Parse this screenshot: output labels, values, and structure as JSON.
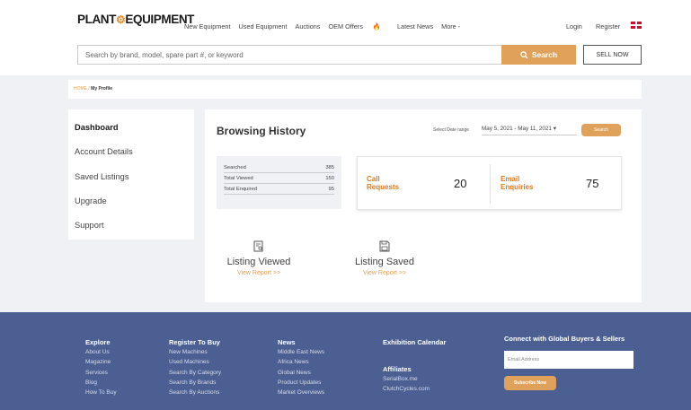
{
  "header": {
    "logo": "PLANT & EQUIPMENT",
    "nav": [
      "New Equipment",
      "Used Equipment",
      "Auctions",
      "OEM Offers",
      "Latest News",
      "More -"
    ],
    "login": "Login",
    "register": "Register"
  },
  "search": {
    "placeholder": "Search by brand, model, spare part #, or keyword",
    "button": "Search",
    "sell": "SELL NOW"
  },
  "breadcrumb": {
    "home": "HOME",
    "separator": "/",
    "current": "My Profile"
  },
  "sidebar": {
    "items": [
      "Dashboard",
      "Account Details",
      "Saved Listings",
      "Upgrade",
      "Support"
    ]
  },
  "main": {
    "title": "Browsing History",
    "date_label": "Select Date range",
    "date_range": "May 5, 2021 - May 11, 2021",
    "date_button": "Search",
    "stats": [
      {
        "label": "Searched",
        "value": "385"
      },
      {
        "label": "Total Viewed",
        "value": "150"
      },
      {
        "label": "Total Enquired",
        "value": "95"
      }
    ],
    "call_label_1": "Call",
    "call_label_2": "Requests",
    "call_value": "20",
    "email_label_1": "Email",
    "email_label_2": "Enquiries",
    "email_value": "75",
    "report_viewed": "Listing Viewed",
    "report_saved": "Listing Saved",
    "report_link": "View Report >>"
  },
  "footer": {
    "explore": {
      "heading": "Explore",
      "links": [
        "About Us",
        "Magazine",
        "Services",
        "Blog",
        "How To Buy"
      ]
    },
    "register_buy": {
      "heading": "Register To Buy",
      "links": [
        "New Machines",
        "Used Machines",
        "Search By Category",
        "Search By Brands",
        "Search By Auctions"
      ]
    },
    "news": {
      "heading": "News",
      "links": [
        "Middle East News",
        "Africa News",
        "Global News",
        "Product Updates",
        "Market Overviews"
      ]
    },
    "exhibition": "Exhibition Calendar",
    "affiliates": {
      "heading": "Affiliates",
      "links": [
        "SerialBox.me",
        "ClutchCycles.com"
      ]
    },
    "connect": "Connect with Global Buyers & Sellers",
    "email_placeholder": "Email Address",
    "subscribe": "Subscribe Now"
  },
  "colors": {
    "accent": "#e0a25b",
    "orange_text": "#e07a1f",
    "footer_bg": "#4b5f92",
    "page_bg": "#f0f1f5"
  }
}
